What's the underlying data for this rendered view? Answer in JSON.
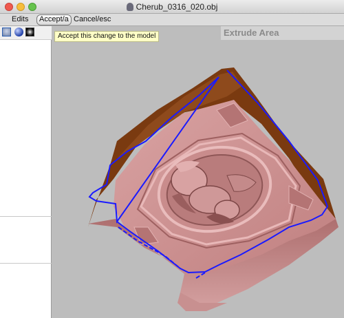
{
  "window": {
    "title": "Cherub_0316_020.obj"
  },
  "toolbar": {
    "edits_label": "Edits",
    "accept_label": "Accept/a",
    "cancel_label": "Cancel/esc"
  },
  "tooltip": {
    "text": "Accept this change to the model"
  },
  "panel": {
    "title": "Extrude Area"
  },
  "sidebar": {
    "tools": [
      {
        "icon": "model-view-icon"
      },
      {
        "icon": "sphere-shading-icon"
      },
      {
        "icon": "black-material-icon"
      }
    ]
  },
  "colors": {
    "model_surface": "#c68a8a",
    "model_shadow": "#8c5858",
    "extrude_wall": "#7a3a10",
    "selection_outline": "#1a1aff",
    "viewport_bg": "#bdbdbd"
  }
}
